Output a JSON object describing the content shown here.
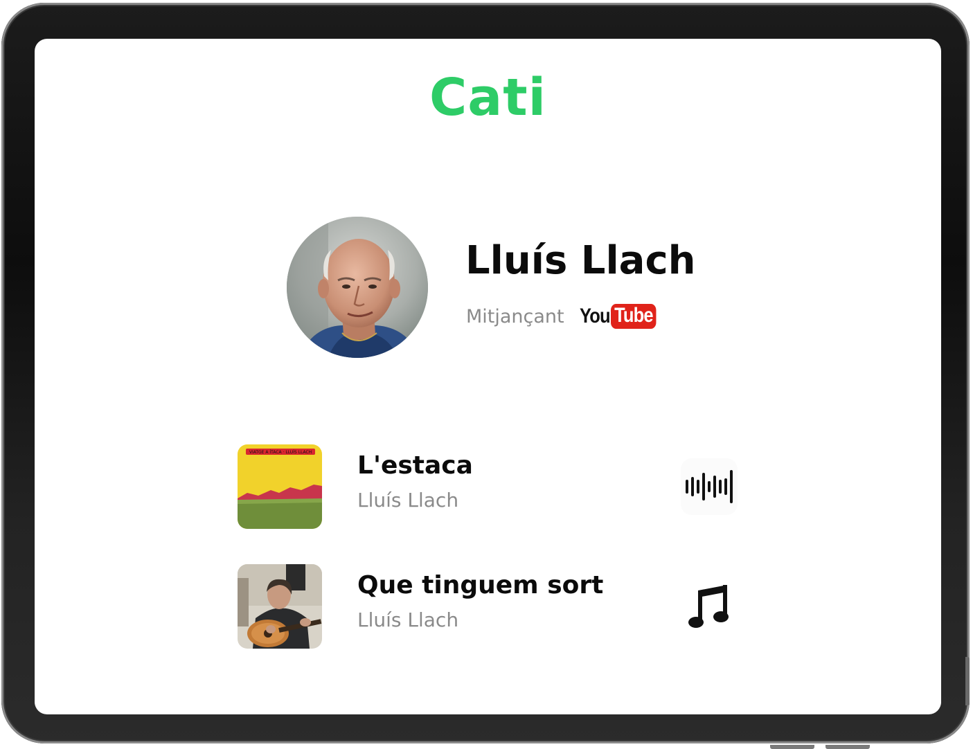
{
  "app": {
    "title": "Cati",
    "brand_color": "#2ecc67"
  },
  "artist": {
    "name": "Lluís Llach",
    "via_label": "Mitjançant",
    "source_logo": {
      "name": "youtube-logo",
      "part1": "You",
      "part2": "Tube",
      "color": "#e0231a"
    },
    "photo_icon": "artist-portrait"
  },
  "songs": [
    {
      "title": "L'estaca",
      "artist": "Lluís Llach",
      "cover_icon": "album-cover-landscape",
      "cover_text": "VIATGE A ÍTACA · LLUÍS LLACH",
      "action_icon": "audio-waveform-icon"
    },
    {
      "title": "Que tinguem sort",
      "artist": "Lluís Llach",
      "cover_icon": "guitarist-photo",
      "action_icon": "music-note-icon"
    }
  ]
}
